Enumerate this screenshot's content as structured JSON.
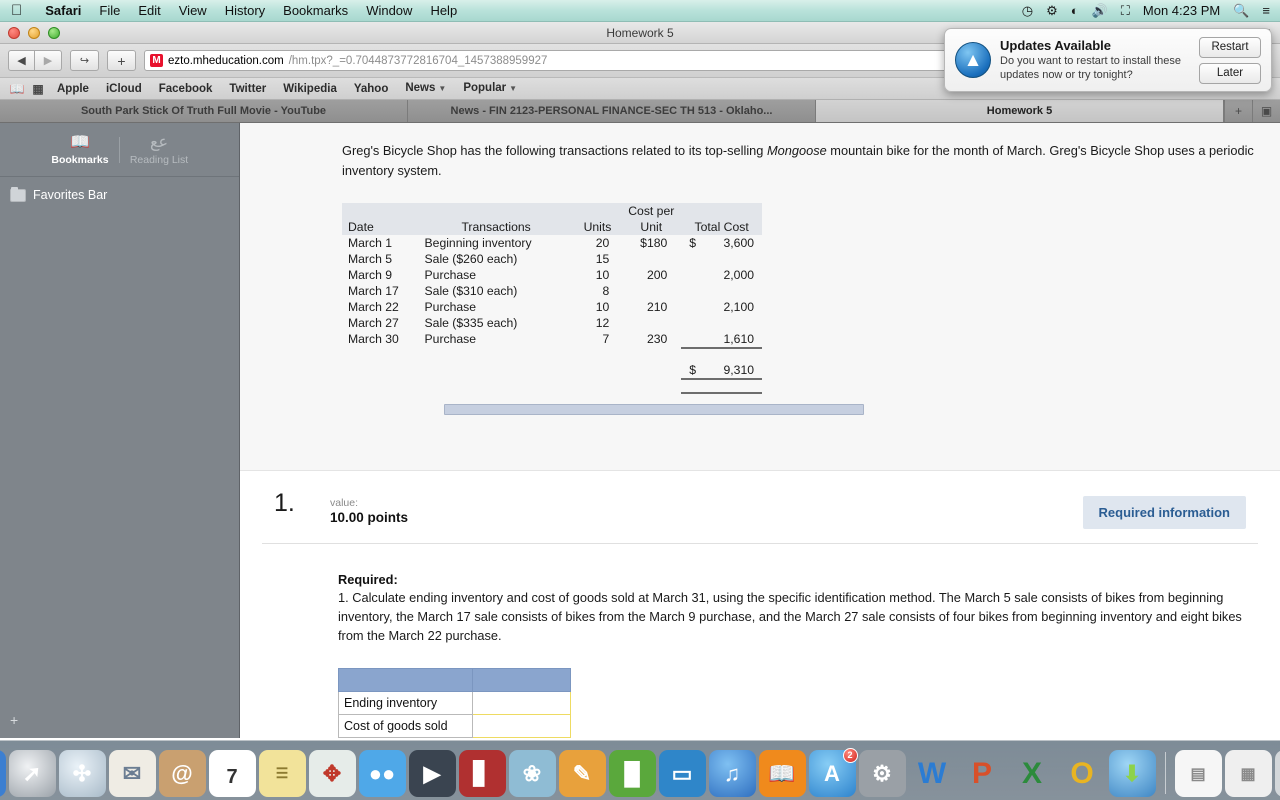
{
  "menubar": {
    "apple_glyph": "&#63743;",
    "items": [
      "Safari",
      "File",
      "Edit",
      "View",
      "History",
      "Bookmarks",
      "Window",
      "Help"
    ],
    "right_icons": [
      "time-machine-icon",
      "bluetooth-icon",
      "wifi-icon",
      "volume-icon",
      "battery-icon",
      "spotlight-icon",
      "notification-center-icon"
    ],
    "clock": "Mon 4:23 PM"
  },
  "window": {
    "title": "Homework 5"
  },
  "toolbar": {
    "back_label": "◀",
    "forward_label": "▶",
    "share_label": "↪",
    "new_tab_label": "+",
    "favicon_letter": "M",
    "url_host": "ezto.mheducation.com",
    "url_path": "/hm.tpx?_=0.7044873772816704_1457388959927"
  },
  "bookmarks_bar": {
    "items": [
      "Apple",
      "iCloud",
      "Facebook",
      "Twitter",
      "Wikipedia",
      "Yahoo",
      "News",
      "Popular"
    ],
    "dropdown_items": [
      "News",
      "Popular"
    ]
  },
  "tabs": [
    {
      "label": "South Park Stick Of Truth Full Movie - YouTube",
      "active": false
    },
    {
      "label": "News - FIN 2123-PERSONAL FINANCE-SEC TH 513 - Oklaho...",
      "active": false
    },
    {
      "label": "Homework 5",
      "active": true
    }
  ],
  "tabbar_buttons": {
    "new_tab": "+",
    "show_all_tabs": "▣"
  },
  "sidebar": {
    "tabs": [
      {
        "label": "Bookmarks",
        "icon": "book-icon",
        "glyph": "📖",
        "active": true
      },
      {
        "label": "Reading List",
        "icon": "glasses-icon",
        "glyph": "œœ",
        "active": false
      }
    ],
    "items": [
      {
        "label": "Favorites Bar",
        "icon": "folder-icon"
      }
    ],
    "add_button": "+"
  },
  "content": {
    "intro_before": "Greg's Bicycle Shop has the following transactions related to its top-selling ",
    "intro_italic": "Mongoose",
    "intro_after": " mountain bike for the month of March. Greg's Bicycle Shop uses a periodic inventory system.",
    "table": {
      "headers_top": [
        "",
        "",
        "",
        "Cost per",
        ""
      ],
      "headers": [
        "Date",
        "Transactions",
        "Units",
        "Unit",
        "Total Cost"
      ],
      "rows": [
        {
          "date": "March 1",
          "transaction": "Beginning inventory",
          "units": "20",
          "cost_per_unit": "$180",
          "total_cost": "3,600",
          "total_dollar": "$"
        },
        {
          "date": "March 5",
          "transaction": "Sale ($260 each)",
          "units": "15",
          "cost_per_unit": "",
          "total_cost": "",
          "total_dollar": ""
        },
        {
          "date": "March 9",
          "transaction": "Purchase",
          "units": "10",
          "cost_per_unit": "200",
          "total_cost": "2,000",
          "total_dollar": ""
        },
        {
          "date": "March 17",
          "transaction": "Sale ($310 each)",
          "units": "8",
          "cost_per_unit": "",
          "total_cost": "",
          "total_dollar": ""
        },
        {
          "date": "March 22",
          "transaction": "Purchase",
          "units": "10",
          "cost_per_unit": "210",
          "total_cost": "2,100",
          "total_dollar": ""
        },
        {
          "date": "March 27",
          "transaction": "Sale ($335 each)",
          "units": "12",
          "cost_per_unit": "",
          "total_cost": "",
          "total_dollar": ""
        },
        {
          "date": "March 30",
          "transaction": "Purchase",
          "units": "7",
          "cost_per_unit": "230",
          "total_cost": "1,610",
          "total_dollar": ""
        }
      ],
      "total_dollar": "$",
      "total_value": "9,310"
    }
  },
  "question": {
    "number": "1.",
    "value_label": "value:",
    "points": "10.00 points",
    "required_badge": "Required information",
    "required_title": "Required:",
    "required_text": "1. Calculate ending inventory and cost of goods sold at March 31, using the specific identification method. The March 5 sale consists of bikes from beginning inventory, the March 17 sale consists of bikes from the March 9 purchase, and the March 27 sale consists of four bikes from beginning inventory and eight bikes from the March 22 purchase.",
    "answer_table": {
      "header_left": "",
      "header_right": "",
      "rows": [
        {
          "label": "Ending inventory",
          "value": ""
        },
        {
          "label": "Cost of goods sold",
          "value": ""
        }
      ]
    }
  },
  "notification": {
    "icon": "app-store-icon",
    "title": "Updates Available",
    "body": "Do you want to restart to install these updates now or try tonight?",
    "primary_button": "Restart",
    "secondary_button": "Later"
  },
  "dock": {
    "items": [
      {
        "name": "finder",
        "glyph": "◑",
        "bg": "#3c7fd1"
      },
      {
        "name": "launchpad",
        "glyph": "🚀",
        "bg": "#c4c9ce"
      },
      {
        "name": "safari",
        "glyph": "◉",
        "bg": "#d6dde4"
      },
      {
        "name": "mail",
        "glyph": "✉",
        "bg": "#e9e6df"
      },
      {
        "name": "contacts",
        "glyph": "@",
        "bg": "#c9a070"
      },
      {
        "name": "calendar",
        "glyph": "7",
        "bg": "#ffffff"
      },
      {
        "name": "notes",
        "glyph": "☰",
        "bg": "#f2e39a"
      },
      {
        "name": "maps",
        "glyph": "◳",
        "bg": "#e6ece9"
      },
      {
        "name": "messages",
        "glyph": "💬",
        "bg": "#4fa8e8"
      },
      {
        "name": "facetime",
        "glyph": "▶",
        "bg": "#3a4450"
      },
      {
        "name": "photo-booth",
        "glyph": "█",
        "bg": "#b03030"
      },
      {
        "name": "iphoto",
        "glyph": "❀",
        "bg": "#8fbcd4"
      },
      {
        "name": "pages",
        "glyph": "✎",
        "bg": "#e8a13c"
      },
      {
        "name": "numbers",
        "glyph": "█",
        "bg": "#5aa83c"
      },
      {
        "name": "keynote",
        "glyph": "▭",
        "bg": "#2f86c9"
      },
      {
        "name": "itunes",
        "glyph": "♫",
        "bg": "#3f87d6"
      },
      {
        "name": "ibooks",
        "glyph": "📖",
        "bg": "#f08a1c"
      },
      {
        "name": "app-store",
        "glyph": "A",
        "bg": "#3f9be0",
        "badge": "2"
      },
      {
        "name": "system-preferences",
        "glyph": "⚙",
        "bg": "#9aa0a6"
      },
      {
        "name": "word",
        "glyph": "W",
        "bg": "#2b7cd3"
      },
      {
        "name": "powerpoint",
        "glyph": "P",
        "bg": "#d8502a"
      },
      {
        "name": "excel",
        "glyph": "X",
        "bg": "#2c8b3c"
      },
      {
        "name": "outlook",
        "glyph": "O",
        "bg": "#e8b422"
      },
      {
        "name": "downloader",
        "glyph": "⬇",
        "bg": "#4a9bd4"
      }
    ],
    "right_items": [
      {
        "name": "documents-stack",
        "glyph": "▤",
        "bg": "#f2f2f2"
      },
      {
        "name": "downloads-stack",
        "glyph": "▦",
        "bg": "#eeeeee"
      },
      {
        "name": "trash",
        "glyph": "🗑",
        "bg": "#d3d7da"
      }
    ]
  }
}
